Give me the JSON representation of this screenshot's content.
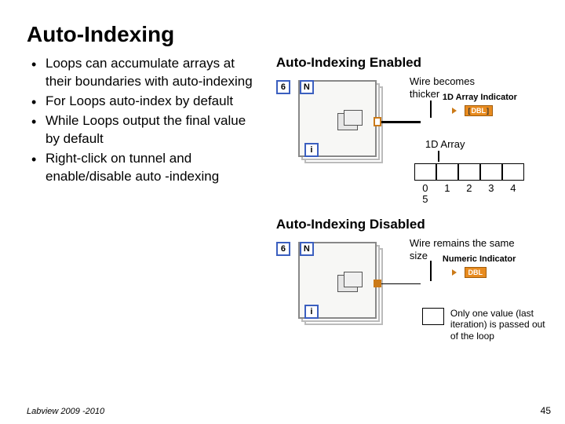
{
  "slide": {
    "title": "Auto-Indexing",
    "bullets": [
      "Loops can accumulate arrays at their boundaries with auto-indexing",
      "For Loops auto-index by default",
      "While Loops output the final value by default",
      "Right-click on tunnel and enable/disable auto -indexing"
    ],
    "footer": "Labview 2009 -2010",
    "page": "45"
  },
  "enabled": {
    "heading": "Auto-Indexing Enabled",
    "iterations": "6",
    "N": "N",
    "i": "i",
    "wire_note": "Wire becomes thicker",
    "indicator_label": "1D Array Indicator",
    "indicator_tag": "DBL",
    "array_label": "1D Array",
    "axis": {
      "v0": "0",
      "v1": "1",
      "v2": "2",
      "v3": "3",
      "v4": "4",
      "v5": "5"
    }
  },
  "disabled": {
    "heading": "Auto-Indexing Disabled",
    "iterations": "6",
    "N": "N",
    "i": "i",
    "wire_note": "Wire remains the same size",
    "indicator_label": "Numeric Indicator",
    "indicator_tag": "DBL",
    "value_note": "Only one value (last iteration) is passed out of the loop"
  }
}
